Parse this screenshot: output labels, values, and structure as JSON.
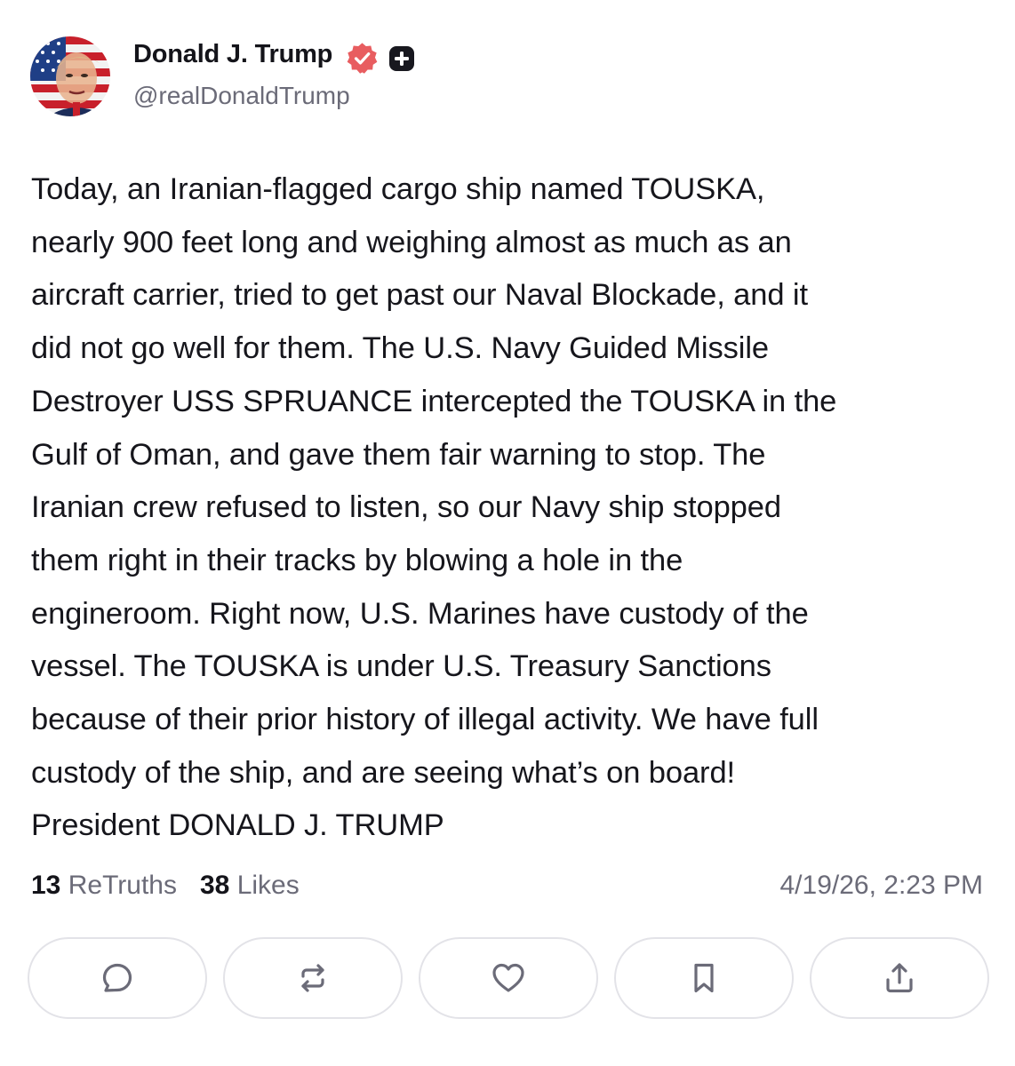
{
  "author": {
    "display_name": "Donald J. Trump",
    "handle": "@realDonaldTrump",
    "avatar_icon": "flag-portrait-avatar",
    "verified_icon": "verified-badge-icon",
    "verified_color": "#e85d60",
    "plus_icon": "plus-badge-icon"
  },
  "post": {
    "lines": [
      "Today, an Iranian-flagged cargo ship named TOUSKA,",
      "nearly 900 feet long and weighing almost as much as an",
      "aircraft carrier, tried to get past our Naval Blockade, and it",
      "did not go well for them. The U.S. Navy Guided Missile",
      "Destroyer USS SPRUANCE intercepted the TOUSKA in the",
      "Gulf of Oman, and gave them fair warning to stop. The",
      "Iranian crew refused to listen, so our Navy ship stopped",
      "them right in their tracks by blowing a hole in the",
      "engineroom. Right now, U.S. Marines have custody of the",
      "vessel. The TOUSKA is under U.S. Treasury Sanctions",
      "because of their prior history of illegal activity. We have full",
      "custody of the ship, and are seeing what’s on board!",
      "President DONALD J. TRUMP"
    ]
  },
  "stats": {
    "retruths_count": "13",
    "retruths_label": "ReTruths",
    "likes_count": "38",
    "likes_label": "Likes",
    "timestamp": "4/19/26, 2:23 PM"
  },
  "actions": [
    {
      "icon": "reply-icon"
    },
    {
      "icon": "retruth-icon"
    },
    {
      "icon": "like-heart-icon"
    },
    {
      "icon": "bookmark-icon"
    },
    {
      "icon": "share-icon"
    }
  ]
}
